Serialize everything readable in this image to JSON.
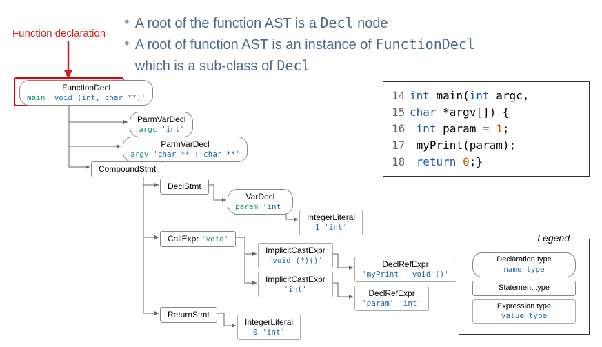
{
  "bullets": {
    "b1_pre": "A root of the function AST is a ",
    "b1_mono": "Decl",
    "b1_post": " node",
    "b2_pre": "A root of function AST is an instance of ",
    "b2_mono": "FunctionDecl",
    "b3_pre": "which is a sub-class of ",
    "b3_mono": "Decl"
  },
  "callout": "Function declaration",
  "nodes": {
    "funcdecl": {
      "title": "FunctionDecl",
      "sub_name": "main",
      "sub_type": "'void (int, char **)'"
    },
    "parm1": {
      "title": "ParmVarDecl",
      "sub_name": "argc",
      "sub_type": "'int'"
    },
    "parm2": {
      "title": "ParmVarDecl",
      "sub_name": "argv",
      "sub_type": "'char **':'char **'"
    },
    "compound": {
      "title": "CompoundStmt"
    },
    "declstmt": {
      "title": "DeclStmt"
    },
    "vardecl": {
      "title": "VarDecl",
      "sub_name": "param",
      "sub_type": "'int'"
    },
    "intlit1": {
      "title": "IntegerLiteral",
      "val": "1 'int'"
    },
    "callexpr": {
      "title": "CallExpr",
      "type": "'void'"
    },
    "impcast1": {
      "title": "ImplicitCastExpr",
      "val": "'void (*)()'"
    },
    "declref1": {
      "title": "DeclRefExpr",
      "val": "'myPrint' 'void ()'"
    },
    "impcast2": {
      "title": "ImplicitCastExpr",
      "val": "'int'"
    },
    "declref2": {
      "title": "DeclRefExpr",
      "val": "'param' 'int'"
    },
    "return": {
      "title": "ReturnStmt"
    },
    "intlit2": {
      "title": "IntegerLiteral",
      "val": "0 'int'"
    }
  },
  "code": {
    "l14": {
      "num": "14",
      "text_kw1": "int",
      "text_mid": " main(",
      "text_kw2": "int",
      "text_end": " argc,"
    },
    "l15": {
      "num": "15",
      "text_kw1": "char",
      "text_end": " *argv[]) {"
    },
    "l16": {
      "num": "16",
      "pad": "  ",
      "text_kw1": "int",
      "text_mid": " param = ",
      "lit": "1",
      "text_end": ";"
    },
    "l17": {
      "num": "17",
      "pad": "  ",
      "text": "myPrint(param);"
    },
    "l18": {
      "num": "18",
      "pad": "  ",
      "text_kw1": "return",
      "text_mid": " ",
      "lit": "0",
      "text_end": ";}"
    }
  },
  "legend": {
    "title": "Legend",
    "decl": {
      "t": "Declaration type",
      "s": "name type"
    },
    "stmt": {
      "t": "Statement type"
    },
    "expr": {
      "t": "Expression type",
      "s": "value type"
    }
  }
}
